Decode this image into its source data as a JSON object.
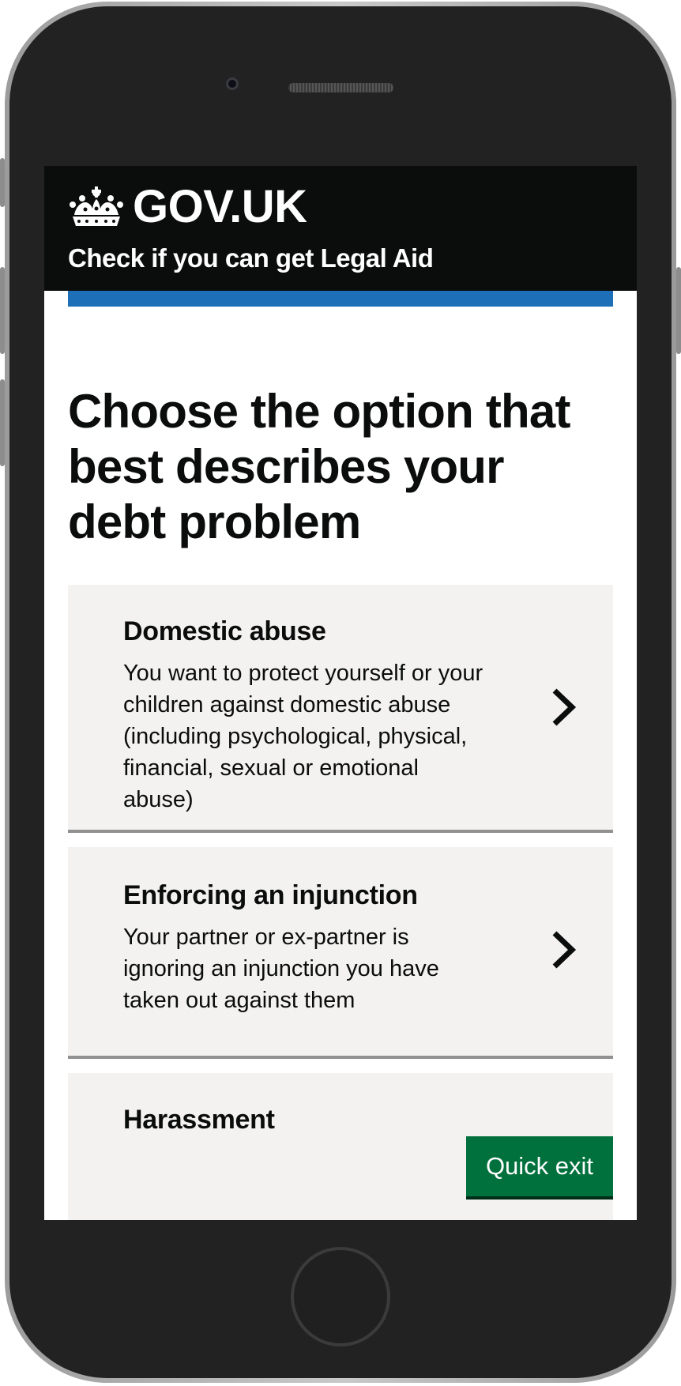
{
  "header": {
    "logo_text": "GOV.UK",
    "service_name": "Check if you can get Legal Aid"
  },
  "page": {
    "title": "Choose the option that best describes your debt problem"
  },
  "options": [
    {
      "title": "Domestic abuse",
      "description": "You want to protect yourself or your children against domestic abuse (including psychological, physical, financial, sexual or emotional abuse)"
    },
    {
      "title": "Enforcing an injunction",
      "description": "Your partner or ex-partner is ignoring an injunction you have taken out against them"
    },
    {
      "title": "Harassment",
      "description": ""
    }
  ],
  "quick_exit": {
    "label": "Quick exit"
  },
  "colors": {
    "header_bg": "#0b0c0c",
    "accent_blue": "#1d70b8",
    "card_bg": "#f3f2f1",
    "quick_exit_green": "#00703c"
  },
  "icons": [
    "crown-icon",
    "chevron-right-icon"
  ]
}
